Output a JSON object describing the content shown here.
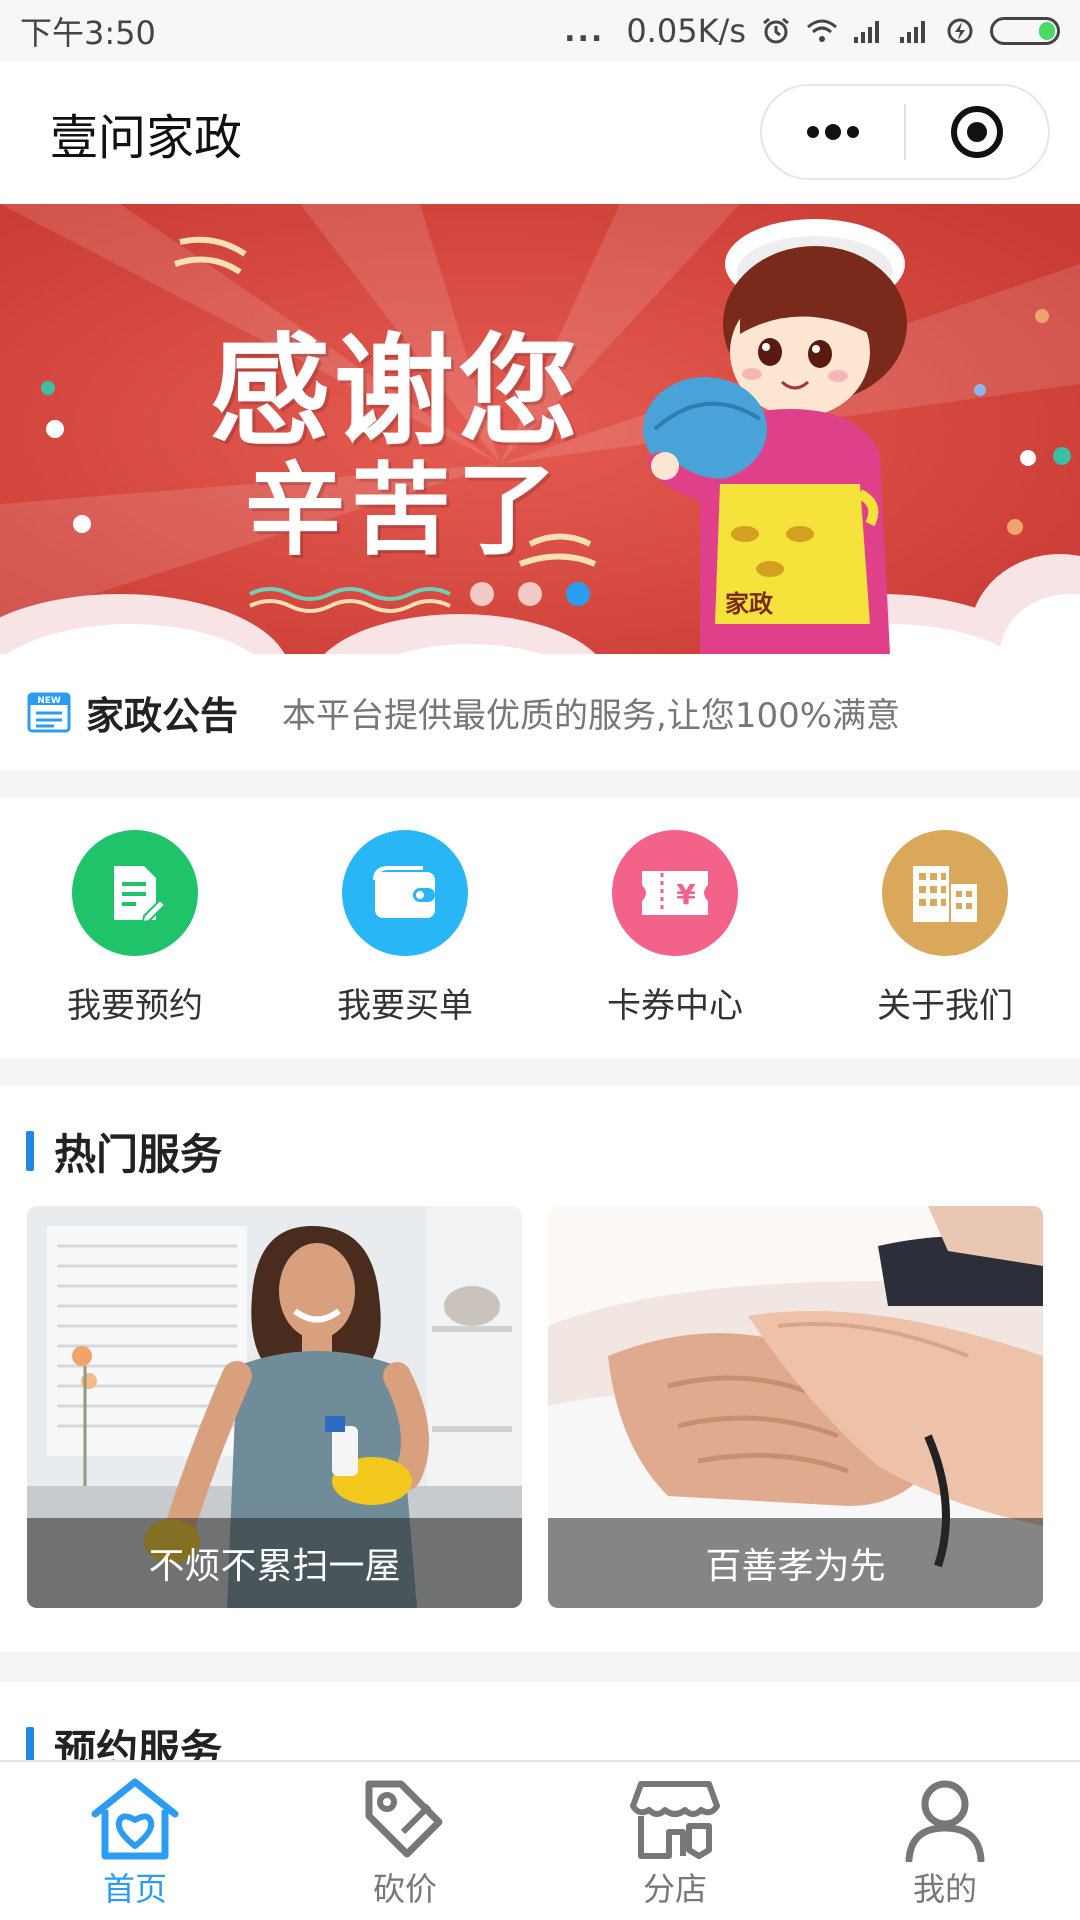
{
  "status_bar": {
    "time": "下午3:50",
    "dots": "...",
    "speed": "0.05K/s"
  },
  "nav": {
    "title": "壹问家政"
  },
  "banner": {
    "line1": "感谢您",
    "line2": "辛苦了",
    "apron_text": "家政",
    "slide_count": 3,
    "active_slide": 3
  },
  "notice": {
    "badge": "NEW",
    "title": "家政公告",
    "text": "本平台提供最优质的服务,让您100%满意"
  },
  "quick_menu": [
    {
      "label": "我要预约",
      "icon": "document-edit-icon",
      "color": "#1fc36a"
    },
    {
      "label": "我要买单",
      "icon": "wallet-icon",
      "color": "#29b6f6"
    },
    {
      "label": "卡券中心",
      "icon": "coupon-icon",
      "color": "#f2628a"
    },
    {
      "label": "关于我们",
      "icon": "building-icon",
      "color": "#d9a85a"
    }
  ],
  "hot_services": {
    "title": "热门服务",
    "cards": [
      {
        "caption": "不烦不累扫一屋"
      },
      {
        "caption": "百善孝为先"
      }
    ]
  },
  "booking": {
    "title": "预约服务"
  },
  "tab_bar": [
    {
      "label": "首页",
      "icon": "home-icon",
      "active": true
    },
    {
      "label": "砍价",
      "icon": "price-tag-icon",
      "active": false
    },
    {
      "label": "分店",
      "icon": "store-icon",
      "active": false
    },
    {
      "label": "我的",
      "icon": "user-icon",
      "active": false
    }
  ],
  "colors": {
    "accent": "#2b9cf2",
    "banner_red": "#d9463f",
    "section_bar": "#1e88e5"
  }
}
